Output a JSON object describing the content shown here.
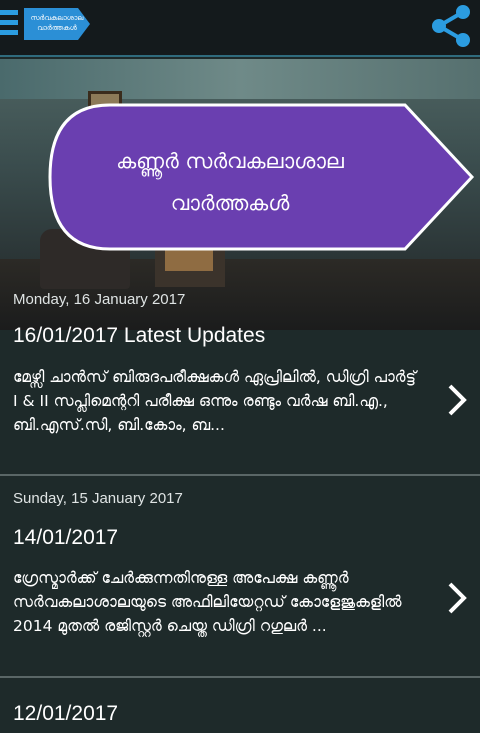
{
  "app": {
    "logo_line1": "സർവകലാശാല",
    "logo_line2": "വാർത്തകൾ",
    "accent": "#2b9ce0",
    "banner_color": "#6a3fb0"
  },
  "banner": {
    "title_line1": "കണ്ണൂർ സർവകലാശാല",
    "title_line2": "വാർത്തകൾ"
  },
  "posts": [
    {
      "date": "Monday, 16 January 2017",
      "title": "16/01/2017 Latest Updates",
      "excerpt": "മേഴ്സി ചാൻസ് ബിരുദപരീക്ഷകൾ ഏപ്രിലിൽ, ഡിഗ്രി പാർട്ട് I & II സപ്ലിമെന്ററി പരീക്ഷ ഒന്നും രണ്ടും വർഷ ബി.എ., ബി.എസ്.സി, ബി.കോം, ബ..."
    },
    {
      "date": "Sunday, 15 January 2017",
      "title": "14/01/2017",
      "excerpt": "ഗ്രേസ്മാർക്ക് ചേർക്കുന്നതിനുള്ള അപേക്ഷ കണ്ണൂർ സർവകലാശാലയുടെ അഫിലിയേറ്റഡ് കോളേജുകളിൽ 2014 മുതൽ രജിസ്റ്റർ ചെയ്ത ഡിഗ്രി റഗുലർ ..."
    },
    {
      "title": "12/01/2017"
    }
  ]
}
